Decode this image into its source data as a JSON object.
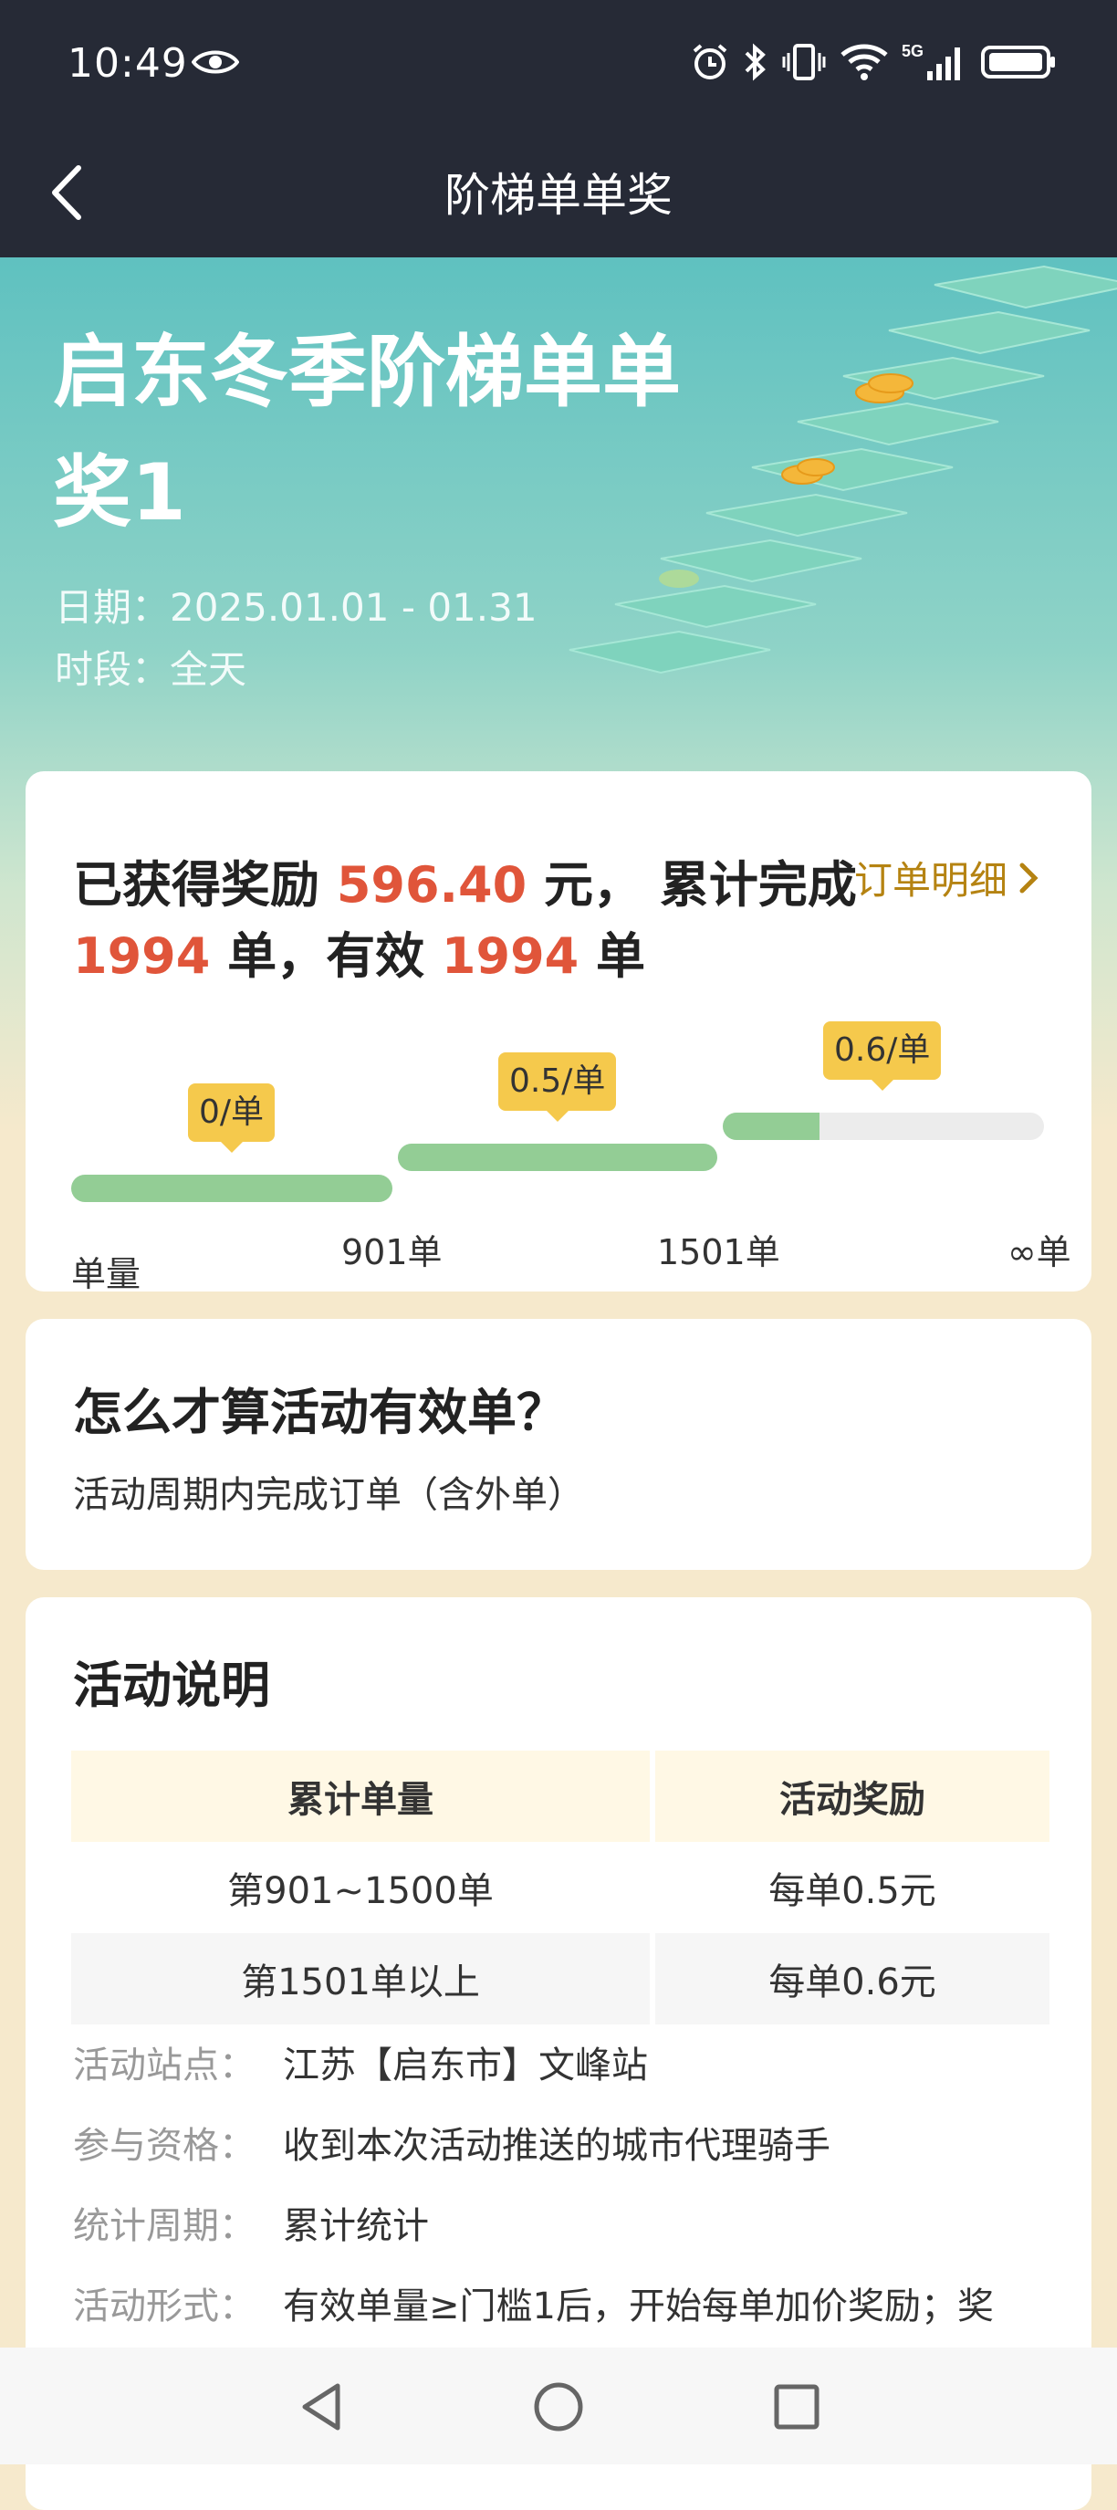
{
  "status": {
    "time": "10:49"
  },
  "header": {
    "title": "阶梯单单奖"
  },
  "hero": {
    "title": "启东冬季阶梯单单奖1",
    "date": "日期：2025.01.01 - 01.31",
    "period": "时段：全天"
  },
  "reward": {
    "prefix": "已获得奖励",
    "amount": "596.40",
    "unit": "元，",
    "completed_label": "累计完成",
    "completed": "1994",
    "completed_unit": "单，有效",
    "valid": "1994",
    "valid_unit": "单",
    "order_link": "订单明细",
    "tiers": [
      {
        "rate": "0/单"
      },
      {
        "rate": "0.5/单"
      },
      {
        "rate": "0.6/单"
      }
    ],
    "ticks": [
      "单量",
      "901单",
      "1501单",
      "∞单"
    ],
    "current_tier_progress": 0.3
  },
  "valid_section": {
    "title": "怎么才算活动有效单？",
    "text": "活动周期内完成订单（含外单）"
  },
  "desc_section": {
    "title": "活动说明",
    "table": {
      "headers": [
        "累计单量",
        "活动奖励"
      ],
      "rows": [
        [
          "第901~1500单",
          "每单0.5元"
        ],
        [
          "第1501单以上",
          "每单0.6元"
        ]
      ]
    },
    "info": [
      {
        "label": "活动站点：",
        "value": "江苏【启东市】文峰站"
      },
      {
        "label": "参与资格：",
        "value": "收到本次活动推送的城市代理骑手"
      },
      {
        "label": "统计周期：",
        "value": "累计统计"
      },
      {
        "label": "活动形式：",
        "value": "有效单量≥门槛1后，开始每单加价奖励；奖"
      }
    ]
  },
  "colors": {
    "accent": "#e0553a",
    "link": "#b58312",
    "bar": "#93cd95",
    "tag": "#f5c94c",
    "header_bg": "#262a36"
  }
}
